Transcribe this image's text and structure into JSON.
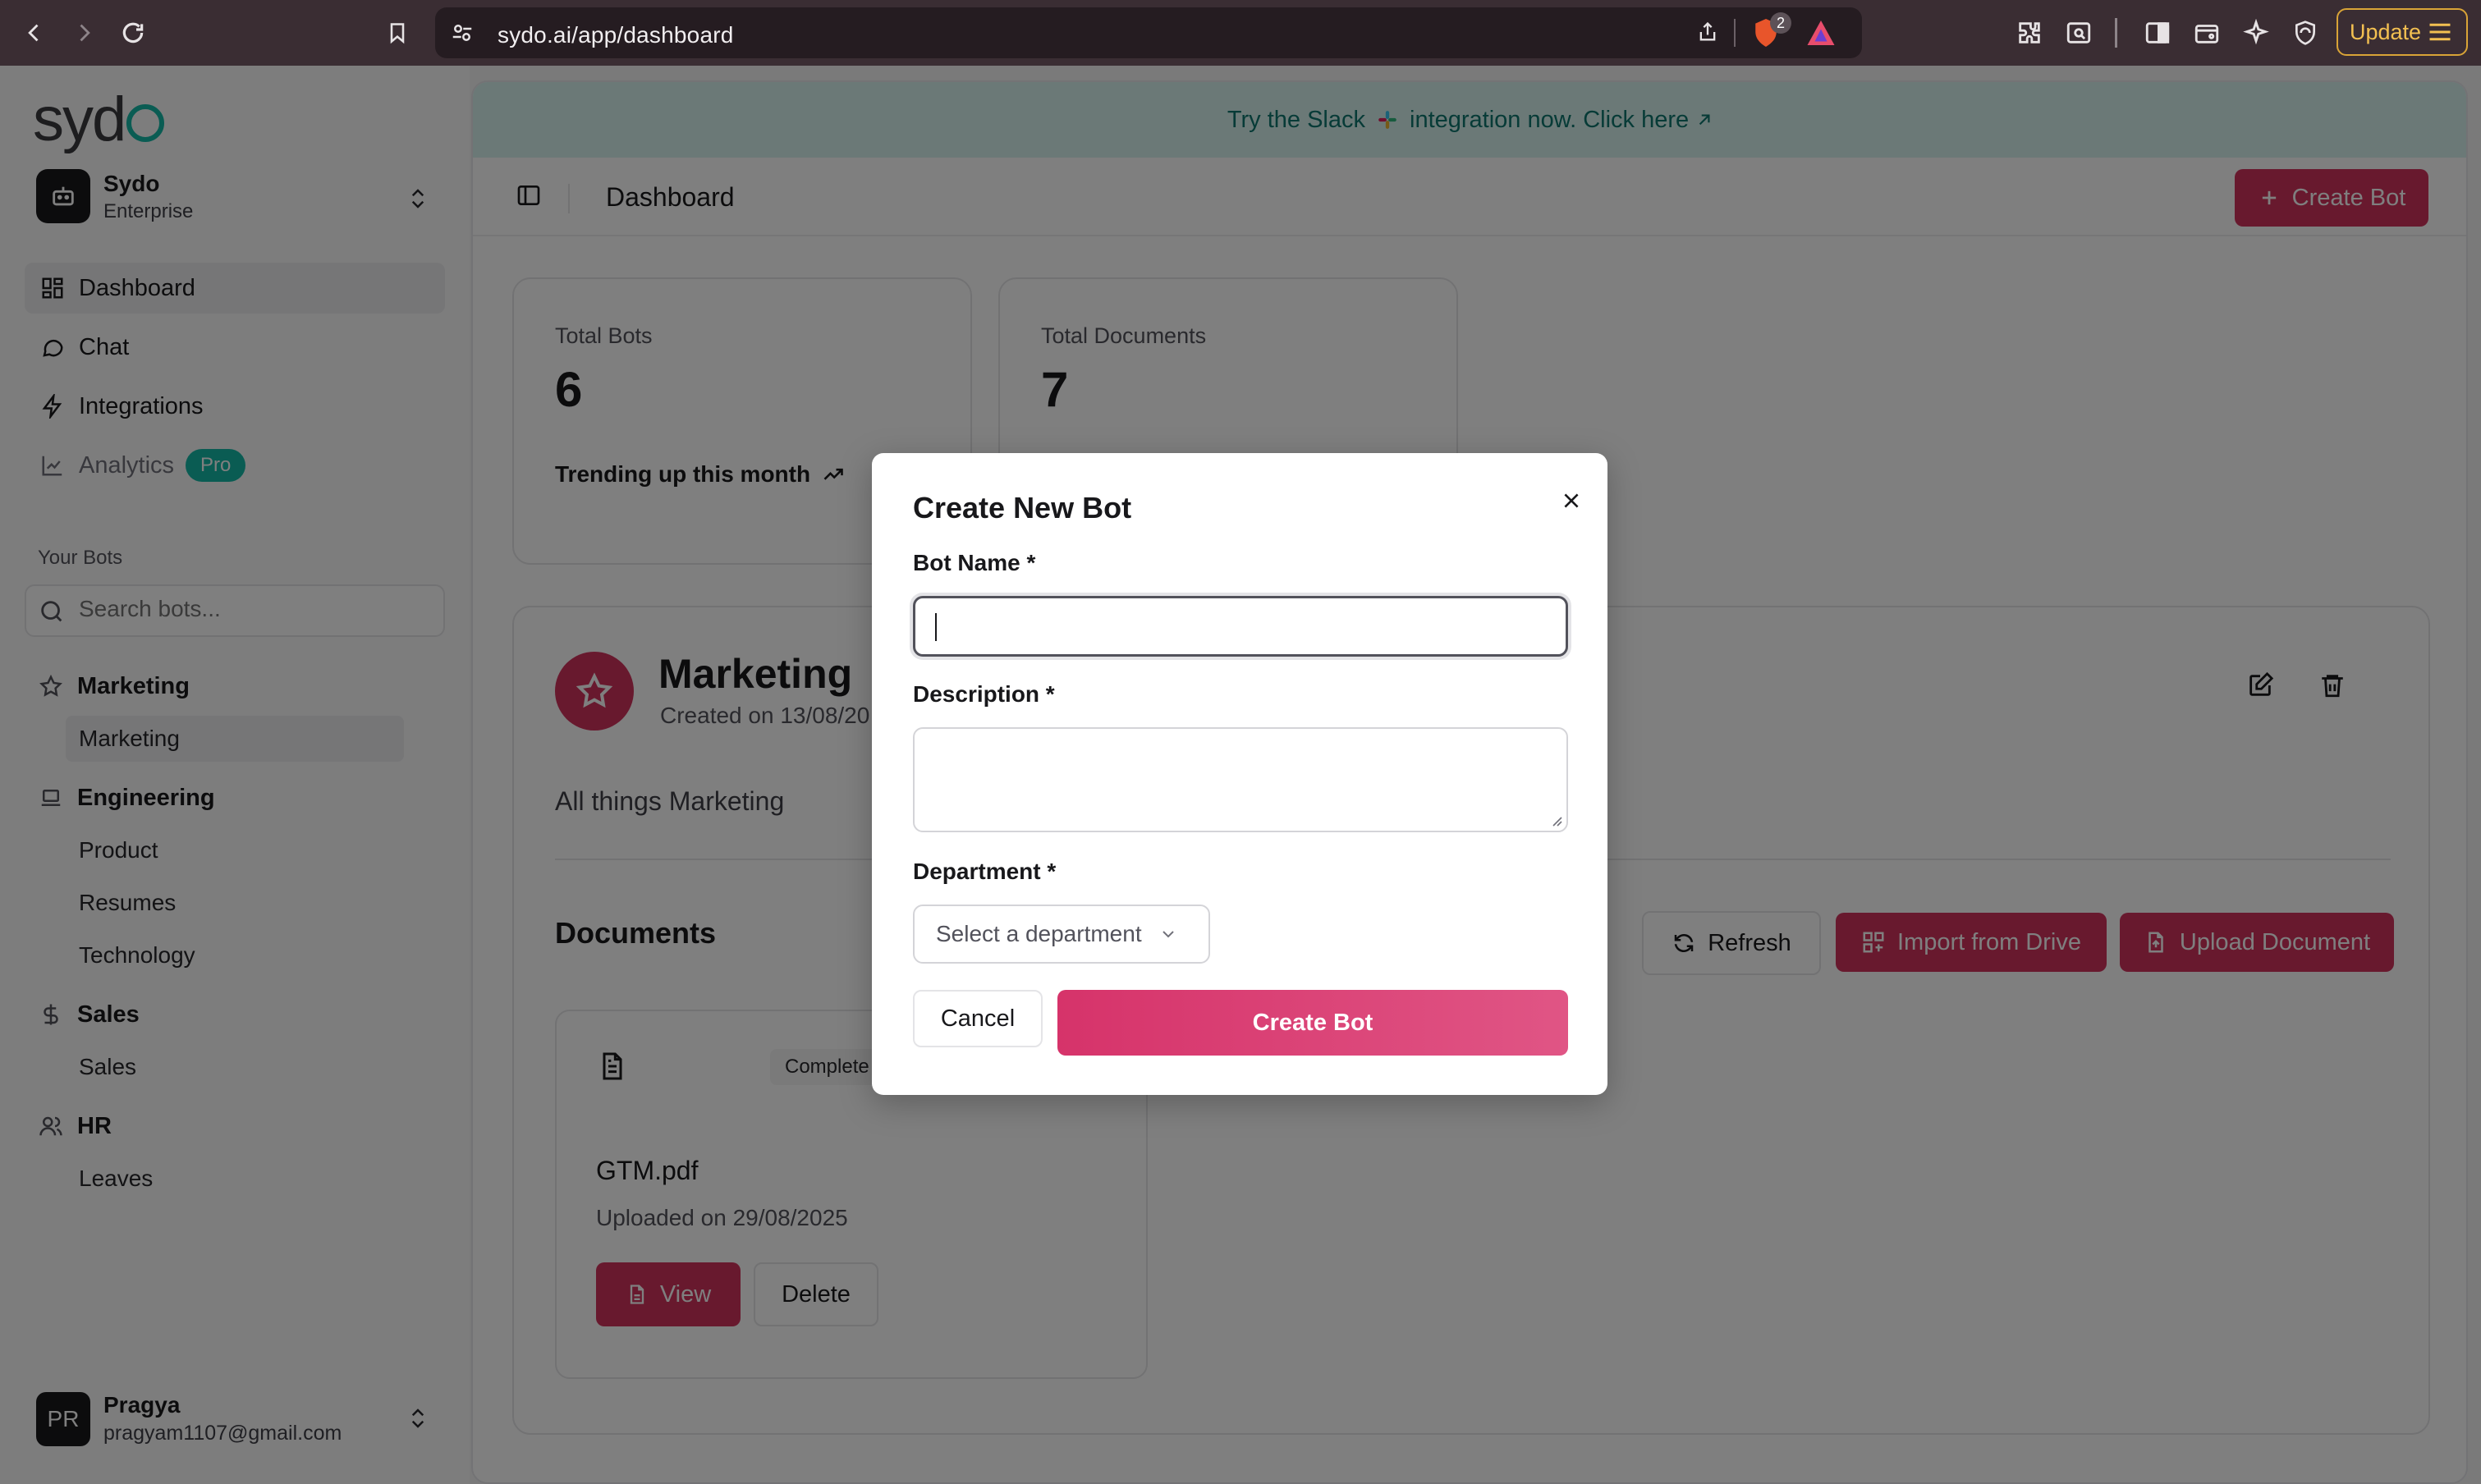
{
  "browser": {
    "url": "sydo.ai/app/dashboard",
    "shield_count": "2",
    "update_label": "Update"
  },
  "sidebar": {
    "logo_text": "syd",
    "workspace": {
      "name": "Sydo",
      "plan": "Enterprise"
    },
    "nav": [
      {
        "label": "Dashboard",
        "icon": "dashboard-icon"
      },
      {
        "label": "Chat",
        "icon": "chat-icon"
      },
      {
        "label": "Integrations",
        "icon": "lightning-icon"
      },
      {
        "label": "Analytics",
        "icon": "chart-icon",
        "badge": "Pro"
      }
    ],
    "your_bots_label": "Your Bots",
    "search_placeholder": "Search bots...",
    "groups": [
      {
        "label": "Marketing",
        "icon": "star-icon",
        "children": [
          "Marketing"
        ]
      },
      {
        "label": "Engineering",
        "icon": "laptop-icon",
        "children": [
          "Product",
          "Resumes",
          "Technology"
        ]
      },
      {
        "label": "Sales",
        "icon": "dollar-icon",
        "children": [
          "Sales"
        ]
      },
      {
        "label": "HR",
        "icon": "users-icon",
        "children": [
          "Leaves"
        ]
      }
    ],
    "user": {
      "initials": "PR",
      "name": "Pragya",
      "email": "pragyam1107@gmail.com"
    }
  },
  "banner": {
    "text_before": "Try the Slack",
    "text_after": "integration now. Click here"
  },
  "header": {
    "title": "Dashboard",
    "create_label": "Create Bot"
  },
  "stats": [
    {
      "label": "Total Bots",
      "value": "6",
      "trend": "Trending up this month"
    },
    {
      "label": "Total Documents",
      "value": "7"
    }
  ],
  "bot": {
    "name": "Marketing",
    "created": "Created on 13/08/20",
    "description": "All things Marketing",
    "documents_title": "Documents",
    "refresh_label": "Refresh",
    "import_label": "Import from Drive",
    "upload_label": "Upload Document",
    "doc": {
      "status": "Complete",
      "name": "GTM.pdf",
      "uploaded": "Uploaded on 29/08/2025",
      "view_label": "View",
      "delete_label": "Delete"
    }
  },
  "modal": {
    "title": "Create New Bot",
    "bot_name_label": "Bot Name *",
    "bot_name_value": "",
    "description_label": "Description *",
    "department_label": "Department *",
    "department_placeholder": "Select a department",
    "cancel_label": "Cancel",
    "submit_label": "Create Bot"
  },
  "colors": {
    "accent": "#d1325d",
    "brand_teal": "#14b8a6"
  }
}
